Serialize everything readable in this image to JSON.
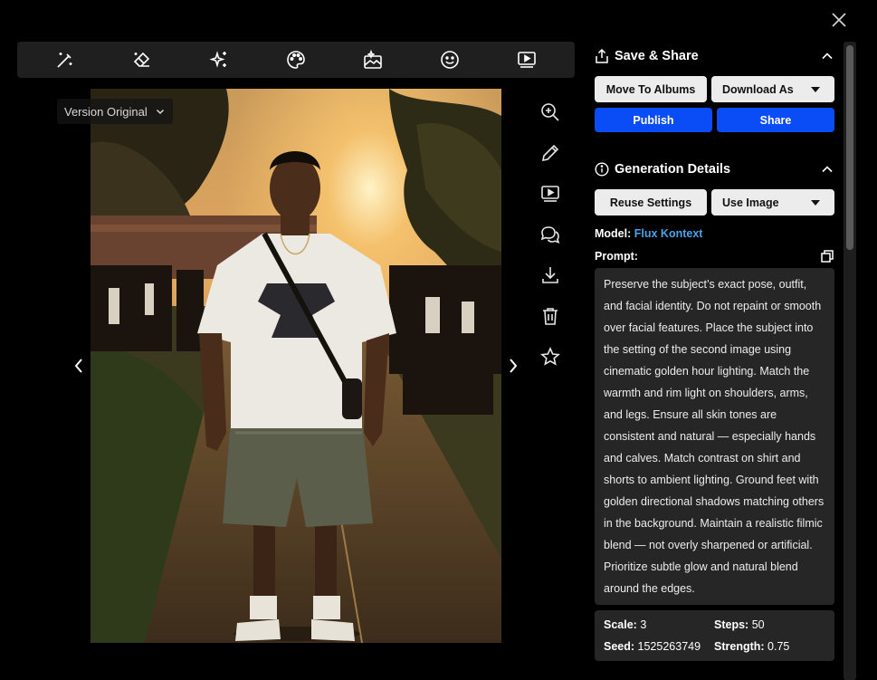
{
  "toolbar": {
    "tools": [
      "magic-wand-icon",
      "eraser-icon",
      "sparkles-icon",
      "palette-icon",
      "image-edit-icon",
      "face-icon",
      "video-icon"
    ]
  },
  "viewer": {
    "version_label": "Version Original"
  },
  "side_tools": [
    "zoom-in-icon",
    "pencil-icon",
    "video-icon",
    "chat-icon",
    "download-icon",
    "trash-icon",
    "star-icon"
  ],
  "save_share": {
    "title": "Save & Share",
    "move_to_albums": "Move To Albums",
    "download_as": "Download As",
    "publish": "Publish",
    "share": "Share"
  },
  "generation": {
    "title": "Generation Details",
    "reuse_settings": "Reuse Settings",
    "use_image": "Use Image",
    "model_label": "Model:",
    "model_value": "Flux Kontext",
    "prompt_label": "Prompt:",
    "prompt": "Preserve the subject’s exact pose, outfit, and facial identity. Do not repaint or smooth over facial features. Place the subject into the setting of the second image using cinematic golden hour lighting. Match the warmth and rim light on shoulders, arms, and legs. Ensure all skin tones are consistent and natural — especially hands and calves. Match contrast on shirt and shorts to ambient lighting. Ground feet with golden directional shadows matching others in the background. Maintain a realistic filmic blend — not overly sharpened or artificial. Prioritize subtle glow and natural blend around the edges.",
    "scale_label": "Scale:",
    "scale_value": "3",
    "steps_label": "Steps:",
    "steps_value": "50",
    "seed_label": "Seed:",
    "seed_value": "1525263749",
    "strength_label": "Strength:",
    "strength_value": "0.75"
  },
  "colors": {
    "accent_blue": "#0a4cf5",
    "link_blue": "#4aa3e8",
    "panel_bg": "#262626",
    "toolbar_bg": "#1f1f1f"
  }
}
